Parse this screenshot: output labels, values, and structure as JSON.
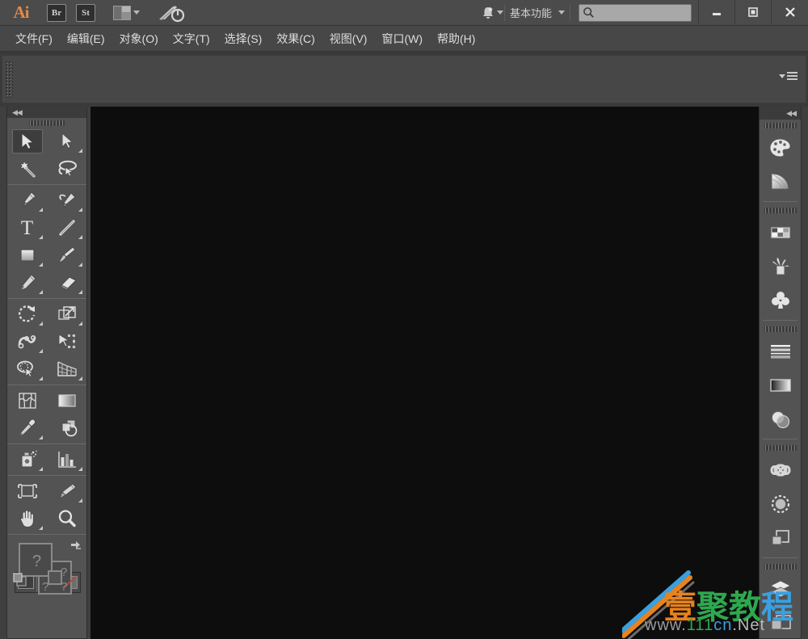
{
  "titlebar": {
    "app_logo": "Ai",
    "bridge_label": "Br",
    "stock_label": "St",
    "arrange_icon": "arrange-documents-icon",
    "rocket_icon": "cc-launch-icon",
    "bell_icon": "notifications-bell-icon",
    "workspace_label": "基本功能",
    "workspace_chevron": "chevron-down-icon",
    "search": {
      "value": "",
      "placeholder": "",
      "icon": "search-icon"
    },
    "minimize": "—",
    "maximize": "□",
    "close": "✕"
  },
  "menubar": {
    "items": [
      {
        "label": "文件(F)"
      },
      {
        "label": "编辑(E)"
      },
      {
        "label": "对象(O)"
      },
      {
        "label": "文字(T)"
      },
      {
        "label": "选择(S)"
      },
      {
        "label": "效果(C)"
      },
      {
        "label": "视图(V)"
      },
      {
        "label": "窗口(W)"
      },
      {
        "label": "帮助(H)"
      }
    ]
  },
  "controlbar": {
    "grip": "panel-grip",
    "menu_icon": "panel-menu-icon",
    "content": ""
  },
  "toolpanel": {
    "collapse_label": "◀◀",
    "grip": "tool-panel-grip",
    "tools": [
      {
        "name": "selection-tool",
        "active": true,
        "corner": false
      },
      {
        "name": "direct-selection-tool",
        "active": false,
        "corner": true
      },
      {
        "name": "magic-wand-tool",
        "active": false,
        "corner": false
      },
      {
        "name": "lasso-tool",
        "active": false,
        "corner": false
      },
      {
        "name": "pen-tool",
        "active": false,
        "corner": true
      },
      {
        "name": "add-anchor-point-tool",
        "active": false,
        "corner": true
      },
      {
        "name": "type-tool",
        "active": false,
        "corner": true
      },
      {
        "name": "line-segment-tool",
        "active": false,
        "corner": true
      },
      {
        "name": "rectangle-tool",
        "active": false,
        "corner": true
      },
      {
        "name": "paintbrush-tool",
        "active": false,
        "corner": true
      },
      {
        "name": "pencil-tool",
        "active": false,
        "corner": true
      },
      {
        "name": "eraser-tool",
        "active": false,
        "corner": true
      },
      {
        "name": "rotate-tool",
        "active": false,
        "corner": true
      },
      {
        "name": "scale-tool",
        "active": false,
        "corner": true
      },
      {
        "name": "width-tool",
        "active": false,
        "corner": true
      },
      {
        "name": "free-transform-tool",
        "active": false,
        "corner": false
      },
      {
        "name": "shape-builder-tool",
        "active": false,
        "corner": true
      },
      {
        "name": "perspective-grid-tool",
        "active": false,
        "corner": true
      },
      {
        "name": "mesh-tool",
        "active": false,
        "corner": false
      },
      {
        "name": "gradient-tool",
        "active": false,
        "corner": false
      },
      {
        "name": "eyedropper-tool",
        "active": false,
        "corner": true
      },
      {
        "name": "blend-tool",
        "active": false,
        "corner": false
      },
      {
        "name": "symbol-sprayer-tool",
        "active": false,
        "corner": true
      },
      {
        "name": "column-graph-tool",
        "active": false,
        "corner": true
      },
      {
        "name": "artboard-tool",
        "active": false,
        "corner": false
      },
      {
        "name": "slice-tool",
        "active": false,
        "corner": true
      },
      {
        "name": "hand-tool",
        "active": false,
        "corner": true
      },
      {
        "name": "zoom-tool",
        "active": false,
        "corner": false
      }
    ],
    "fill_stroke": {
      "fill_label": "?",
      "stroke_label": "?",
      "stroke_small_label": "?",
      "stroke_small_label2": "?",
      "swap_icon": "swap-fill-stroke-icon",
      "default_icon": "default-fill-stroke-icon"
    },
    "screen_modes": [
      {
        "name": "color-mode-button"
      },
      {
        "name": "gradient-mode-button"
      },
      {
        "name": "none-mode-button"
      }
    ]
  },
  "rightdock": {
    "collapse_label": "◀◀",
    "groups": [
      {
        "items": [
          {
            "name": "color-panel-icon"
          },
          {
            "name": "color-guide-panel-icon"
          }
        ]
      },
      {
        "items": [
          {
            "name": "swatches-panel-icon"
          },
          {
            "name": "brushes-panel-icon"
          },
          {
            "name": "symbols-panel-icon"
          }
        ]
      },
      {
        "items": [
          {
            "name": "stroke-panel-icon"
          },
          {
            "name": "gradient-panel-icon"
          },
          {
            "name": "transparency-panel-icon"
          }
        ]
      },
      {
        "items": [
          {
            "name": "appearance-panel-icon"
          },
          {
            "name": "graphic-styles-panel-icon"
          },
          {
            "name": "pathfinder-panel-icon"
          }
        ]
      },
      {
        "items": [
          {
            "name": "layers-panel-icon"
          },
          {
            "name": "artboards-panel-icon"
          }
        ]
      }
    ]
  },
  "watermark": {
    "text_parts": [
      {
        "char": "壹",
        "color": "#e8821c"
      },
      {
        "char": "聚",
        "color": "#2ea84f"
      },
      {
        "char": "教",
        "color": "#2ea84f"
      },
      {
        "char": "程",
        "color": "#3aa0e0"
      }
    ],
    "url_parts": [
      {
        "text": "www.",
        "color": "#9b9b9b"
      },
      {
        "text": "111",
        "color": "#2ea84f"
      },
      {
        "text": "cn",
        "color": "#3aa0e0"
      },
      {
        "text": ".Net",
        "color": "#b9b9b9"
      }
    ]
  },
  "colors": {
    "titlebar_bg": "#4b4b4b",
    "menubar_bg": "#474747",
    "panel_bg": "#535353",
    "canvas_bg": "#0d0d0d",
    "accent_orange": "#e08a4a"
  }
}
